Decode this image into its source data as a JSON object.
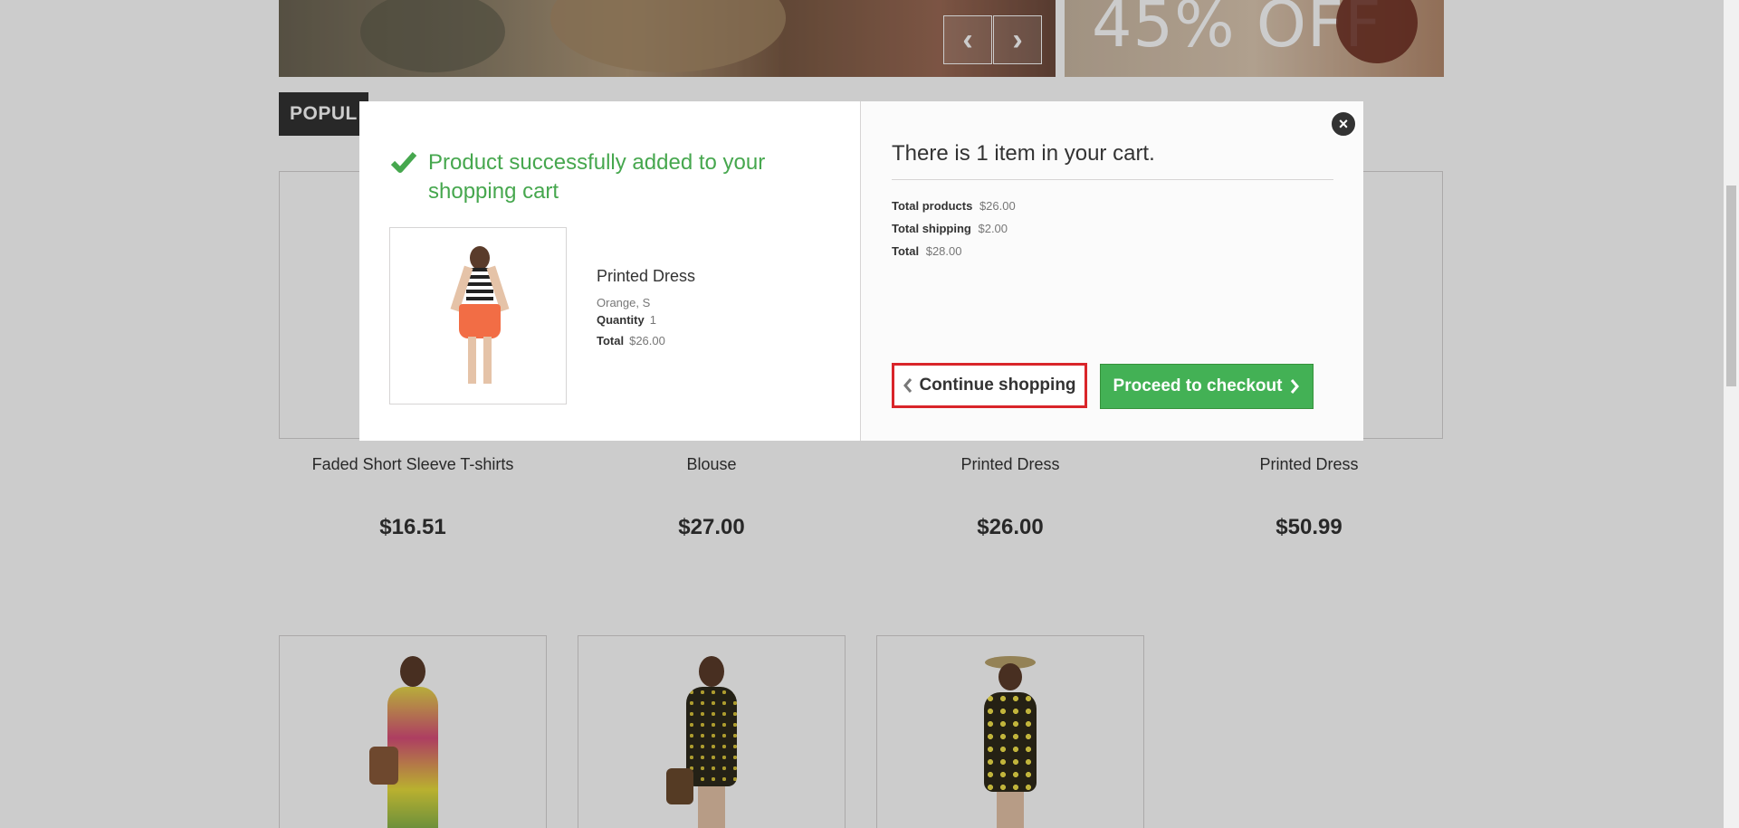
{
  "banner": {
    "promo_text": "45% OFF",
    "prev_glyph": "‹",
    "next_glyph": "›"
  },
  "popular_tab": {
    "label": "POPUL"
  },
  "products_row1": [
    {
      "name": "Faded Short Sleeve T-shirts",
      "price": "$16.51"
    },
    {
      "name": "Blouse",
      "price": "$27.00"
    },
    {
      "name": "Printed Dress",
      "price": "$26.00"
    },
    {
      "name": "Printed Dress",
      "price": "$50.99"
    }
  ],
  "modal": {
    "success_message": "Product successfully added to your shopping cart",
    "product": {
      "name": "Printed Dress",
      "attributes": "Orange, S",
      "quantity_label": "Quantity",
      "quantity": "1",
      "total_label": "Total",
      "total": "$26.00"
    },
    "cart": {
      "heading": "There is 1 item in your cart.",
      "total_products_label": "Total products",
      "total_products": "$26.00",
      "total_shipping_label": "Total shipping",
      "total_shipping": "$2.00",
      "total_label": "Total",
      "total": "$28.00"
    },
    "continue_label": "Continue shopping",
    "checkout_label": "Proceed to checkout",
    "close_glyph": "×"
  },
  "colors": {
    "success_green": "#46a74e",
    "checkout_button": "#43b155",
    "highlight_red": "#d9252a",
    "tab_dark": "#333333"
  },
  "icons": [
    "check-icon",
    "chevron-left-icon",
    "chevron-right-icon",
    "close-icon"
  ]
}
